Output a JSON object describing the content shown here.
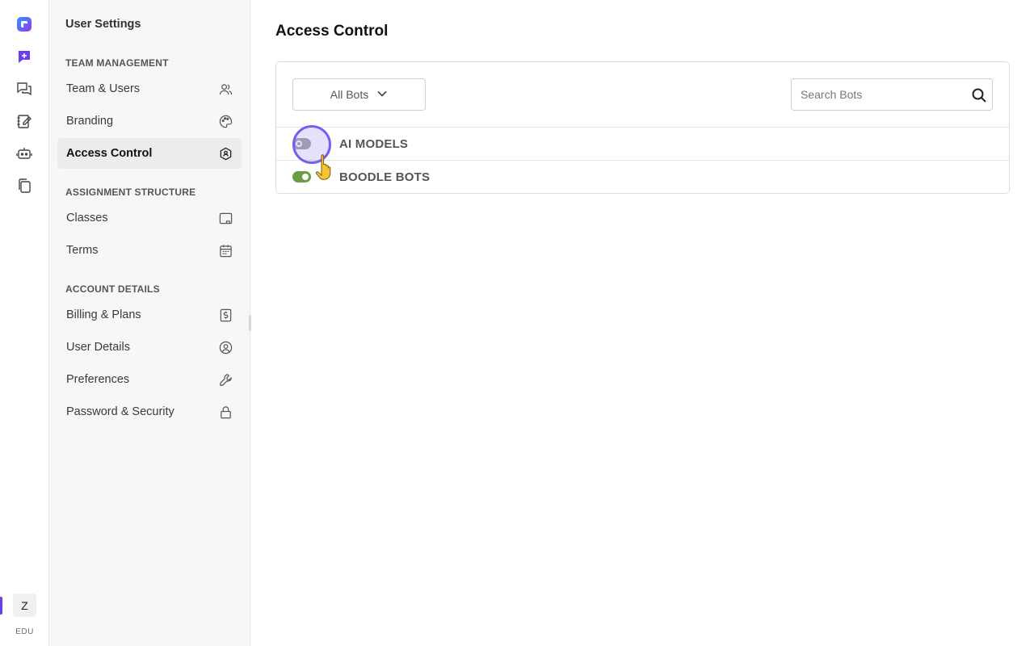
{
  "rail": {
    "icons": [
      "app-logo-icon",
      "new-chat-icon",
      "chats-icon",
      "notebook-icon",
      "bot-icon",
      "copy-docs-icon"
    ],
    "avatar_letter": "Z",
    "plan_label": "EDU",
    "accent_color": "#6a3df0"
  },
  "sidebar": {
    "title": "User Settings",
    "sections": [
      {
        "title": "TEAM MANAGEMENT",
        "items": [
          {
            "label": "Team & Users",
            "icon": "users-icon"
          },
          {
            "label": "Branding",
            "icon": "palette-icon"
          },
          {
            "label": "Access Control",
            "icon": "shield-icon",
            "active": true
          }
        ]
      },
      {
        "title": "ASSIGNMENT STRUCTURE",
        "items": [
          {
            "label": "Classes",
            "icon": "classroom-icon"
          },
          {
            "label": "Terms",
            "icon": "calendar-icon"
          }
        ]
      },
      {
        "title": "ACCOUNT DETAILS",
        "items": [
          {
            "label": "Billing & Plans",
            "icon": "dollar-doc-icon"
          },
          {
            "label": "User Details",
            "icon": "user-circle-icon"
          },
          {
            "label": "Preferences",
            "icon": "wrench-icon"
          },
          {
            "label": "Password & Security",
            "icon": "lock-icon"
          }
        ]
      }
    ]
  },
  "main": {
    "title": "Access Control",
    "filter": {
      "selected": "All Bots"
    },
    "search": {
      "placeholder": "Search Bots",
      "value": ""
    },
    "rows": [
      {
        "label": "AI MODELS",
        "enabled": false
      },
      {
        "label": "BOODLE BOTS",
        "enabled": true
      }
    ],
    "colors": {
      "toggle_on": "#6e9b45",
      "toggle_off": "#a9a9a9",
      "cursor_highlight": "#7b5cf0"
    }
  }
}
